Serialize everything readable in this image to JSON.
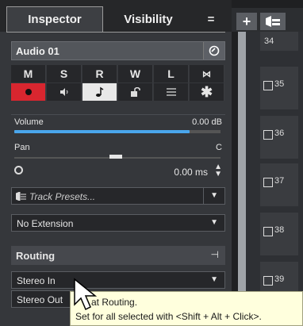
{
  "tabs": {
    "inspector": "Inspector",
    "visibility": "Visibility",
    "menu": "="
  },
  "track": {
    "name": "Audio 01",
    "edit_icon": "e"
  },
  "buttons": {
    "row1": [
      "M",
      "S",
      "R",
      "W",
      "L",
      "⋈"
    ],
    "row2_icons": [
      "record-enable-icon",
      "monitor-icon",
      "timebase-icon",
      "lock-icon",
      "lanes-icon",
      "freeze-icon"
    ]
  },
  "volume": {
    "label": "Volume",
    "value": "0.00 dB",
    "level": 0.85
  },
  "pan": {
    "label": "Pan",
    "value": "C"
  },
  "delay": {
    "value": "0.00 ms"
  },
  "presets": {
    "label": "Track Presets..."
  },
  "extension": {
    "label": "No Extension"
  },
  "routing": {
    "header": "Routing",
    "input": "Stereo In",
    "output": "Stereo Out"
  },
  "tooltip": {
    "line1": "Input Routing.",
    "line1_visible": "at Routing.",
    "line2": "Set for all selected with <Shift + Alt + Click>."
  },
  "lanes": [
    "34",
    "35",
    "36",
    "37",
    "38",
    "39"
  ],
  "toolbar": {
    "add": "+"
  }
}
